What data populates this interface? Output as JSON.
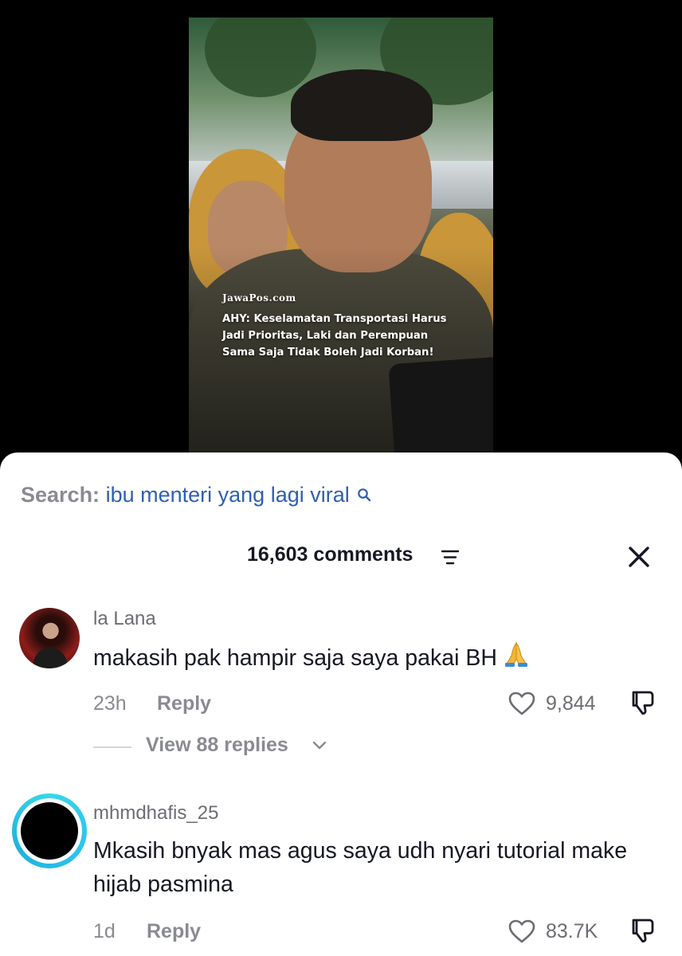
{
  "video": {
    "brand": "JawaPos.com",
    "headline_lines": [
      "AHY: Keselamatan Transportasi Harus",
      "Jadi Prioritas, Laki dan Perempuan",
      "Sama Saja Tidak Boleh Jadi Korban!"
    ]
  },
  "search": {
    "prefix": "Search:",
    "term": "ibu menteri yang lagi viral",
    "icon": "search-icon"
  },
  "comments_header": {
    "count_label": "16,603 comments",
    "filter_icon": "filter-icon",
    "close_icon": "close-icon"
  },
  "comments": [
    {
      "username": "la Lana",
      "text": "makasih pak hampir saja saya pakai BH",
      "emoji": "folded-hands-icon",
      "time": "23h",
      "reply_label": "Reply",
      "likes": "9,844",
      "view_replies": "View 88 replies"
    },
    {
      "username": "mhmdhafis_25",
      "text": "Mkasih bnyak mas agus saya udh nyari tutorial make hijab pasmina",
      "time": "1d",
      "reply_label": "Reply",
      "likes": "83.7K"
    }
  ],
  "colors": {
    "search_term": "#2e5fb3",
    "muted_text": "#8a8b91",
    "primary_text": "#161823",
    "story_ring": "#36d7e8"
  }
}
